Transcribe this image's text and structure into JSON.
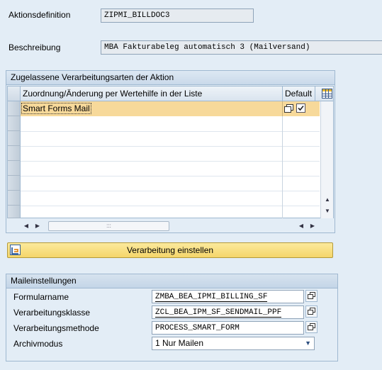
{
  "header": {
    "action_label": "Aktionsdefinition",
    "action_value": "ZIPMI_BILLDOC3",
    "desc_label": "Beschreibung",
    "desc_value": "MBA Fakturabeleg automatisch 3 (Mailversand)"
  },
  "processing_types": {
    "title": "Zugelassene Verarbeitungsarten der Aktion",
    "columns": [
      "Zuordnung/Änderung per Wertehilfe in der Liste",
      "Default"
    ],
    "rows": [
      {
        "name": "Smart Forms Mail",
        "default": true
      }
    ]
  },
  "button": {
    "label": "Verarbeitung einstellen"
  },
  "mail_settings": {
    "title": "Maileinstellungen",
    "fields": [
      {
        "label": "Formularname",
        "value": "ZMBA_BEA_IPMI_BILLING_SF"
      },
      {
        "label": "Verarbeitungsklasse",
        "value": "ZCL_BEA_IPM_SF_SENDMAIL_PPF"
      },
      {
        "label": "Verarbeitungsmethode",
        "value": "PROCESS_SMART_FORM"
      },
      {
        "label": "Archivmodus",
        "value": "1 Nur Mailen"
      }
    ]
  },
  "colors": {
    "background": "#e3edf6",
    "selected_row": "#f7d99a",
    "button": "#f5d66a"
  }
}
